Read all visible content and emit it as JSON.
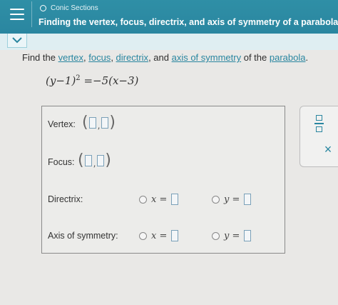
{
  "header": {
    "topic": "Conic Sections",
    "title": "Finding the vertex, focus, directrix, and axis of symmetry of a parabola"
  },
  "prompt": {
    "lead": "Find the ",
    "w_vertex": "vertex",
    "sep1": ", ",
    "w_focus": "focus",
    "sep2": ", ",
    "w_directrix": "directrix",
    "sep3": ", and ",
    "w_axis": "axis of symmetry",
    "mid": " of the ",
    "w_parabola": "parabola",
    "end": "."
  },
  "equation": {
    "left": "(y−1)",
    "power": "2",
    "right": " =−5(x−3)"
  },
  "answers": {
    "vertex_label": "Vertex:",
    "focus_label": "Focus:",
    "directrix_label": "Directrix:",
    "axis_label": "Axis of symmetry:",
    "x_eq": "x =",
    "y_eq": "y =",
    "open_paren": "(",
    "close_paren": ")",
    "comma": ","
  },
  "tools": {
    "clear": "×"
  },
  "colors": {
    "header_bg": "#2f8fa6",
    "link": "#2a86a0"
  }
}
